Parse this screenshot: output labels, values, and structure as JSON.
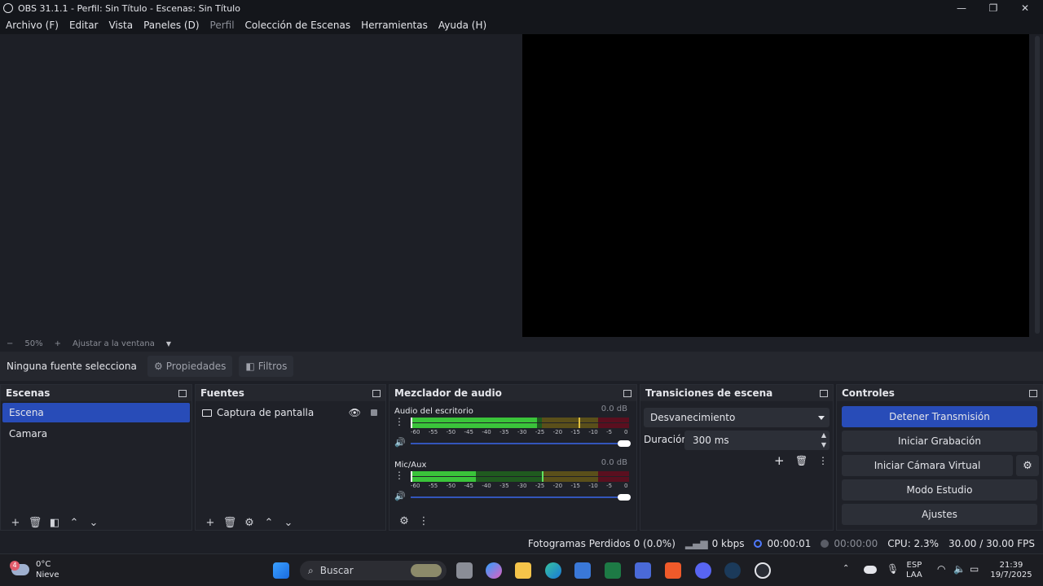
{
  "window": {
    "title": "OBS 31.1.1 - Perfil: Sin Título - Escenas: Sin Título",
    "minimize": "—",
    "maximize": "❐",
    "close": "✕"
  },
  "menu": [
    {
      "label": "Archivo (F)",
      "disabled": false
    },
    {
      "label": "Editar",
      "disabled": false
    },
    {
      "label": "Vista",
      "disabled": false
    },
    {
      "label": "Paneles (D)",
      "disabled": false
    },
    {
      "label": "Perfil",
      "disabled": true
    },
    {
      "label": "Colección de Escenas",
      "disabled": false
    },
    {
      "label": "Herramientas",
      "disabled": false
    },
    {
      "label": "Ayuda (H)",
      "disabled": false
    }
  ],
  "zoom": {
    "minus": "−",
    "level": "50%",
    "plus": "+",
    "fit": "Ajustar a la ventana"
  },
  "properties_bar": {
    "no_selection": "Ninguna fuente selecciona",
    "properties": "Propiedades",
    "filters": "Filtros"
  },
  "scenes": {
    "title": "Escenas",
    "items": [
      "Escena",
      "Camara"
    ],
    "active_index": 0
  },
  "sources": {
    "title": "Fuentes",
    "items": [
      "Captura de pantalla"
    ]
  },
  "mixer": {
    "title": "Mezclador de audio",
    "channels": [
      {
        "name": "Audio del escritorio",
        "db": "0.0 dB",
        "level_a": 0.58,
        "level_b": 0.58,
        "peak": 0.77
      },
      {
        "name": "Mic/Aux",
        "db": "0.0 dB",
        "level_a": 0.3,
        "level_b": 0.3,
        "peak": 0.6
      }
    ],
    "ticks": [
      "-60",
      "-55",
      "-50",
      "-45",
      "-40",
      "-35",
      "-30",
      "-25",
      "-20",
      "-15",
      "-10",
      "-5",
      "0"
    ],
    "volume": 1.0
  },
  "transitions": {
    "title": "Transiciones de escena",
    "selected": "Desvanecimiento",
    "duration_label": "Duración",
    "duration_value": "300 ms"
  },
  "controls": {
    "title": "Controles",
    "stop_stream": "Detener Transmisión",
    "start_recording": "Iniciar Grabación",
    "start_virtual_cam": "Iniciar Cámara Virtual",
    "studio_mode": "Modo Estudio",
    "settings": "Ajustes"
  },
  "status": {
    "dropped_frames": "Fotogramas Perdidos 0 (0.0%)",
    "bitrate": "0 kbps",
    "stream_time": "00:00:01",
    "rec_time": "00:00:00",
    "cpu": "CPU: 2.3%",
    "fps": "30.00 / 30.00 FPS"
  },
  "taskbar": {
    "weather_temp": "0°C",
    "weather_desc": "Nieve",
    "weather_badge": "4",
    "search_placeholder": "Buscar",
    "lang_top": "ESP",
    "lang_bottom": "LAA",
    "time": "21:39",
    "date": "19/7/2025"
  },
  "colors": {
    "accent": "#284cb8",
    "meter_green": "#3ac43a",
    "meter_yellow": "#b3a03a",
    "meter_red": "#a0102a"
  }
}
